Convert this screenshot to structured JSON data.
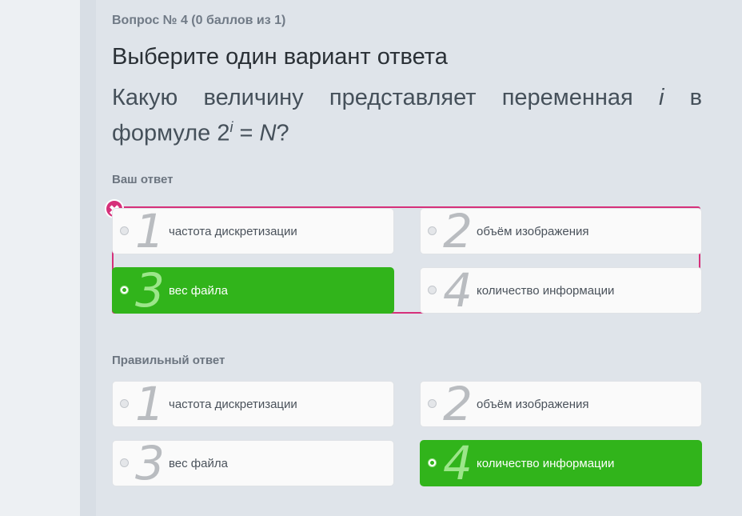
{
  "question": {
    "number_label": "Вопрос № 4 (0 баллов из 1)",
    "type_label": "Выберите один вариант ответа",
    "text_before_var": "Какую величину представляет переменная ",
    "var_i": "i",
    "text_middle": " в формуле 2",
    "superscript": "i",
    "text_equals": " = ",
    "var_N": "N",
    "text_end": "?"
  },
  "your_answer": {
    "label": "Ваш ответ",
    "status": "wrong",
    "badge": "✖",
    "options": [
      {
        "number": "1",
        "label": "частота дискретизации",
        "selected": false
      },
      {
        "number": "2",
        "label": "объём изображения",
        "selected": false
      },
      {
        "number": "3",
        "label": "вес файла",
        "selected": true
      },
      {
        "number": "4",
        "label": "количество информации",
        "selected": false
      }
    ]
  },
  "correct_answer": {
    "label": "Правильный ответ",
    "options": [
      {
        "number": "1",
        "label": "частота дискретизации",
        "selected": false
      },
      {
        "number": "2",
        "label": "объём изображения",
        "selected": false
      },
      {
        "number": "3",
        "label": "вес файла",
        "selected": false
      },
      {
        "number": "4",
        "label": "количество информации",
        "selected": true
      }
    ]
  },
  "colors": {
    "selected_green": "#31b41b",
    "wrong_pink": "#d6307a",
    "background": "#dfe4ea"
  }
}
